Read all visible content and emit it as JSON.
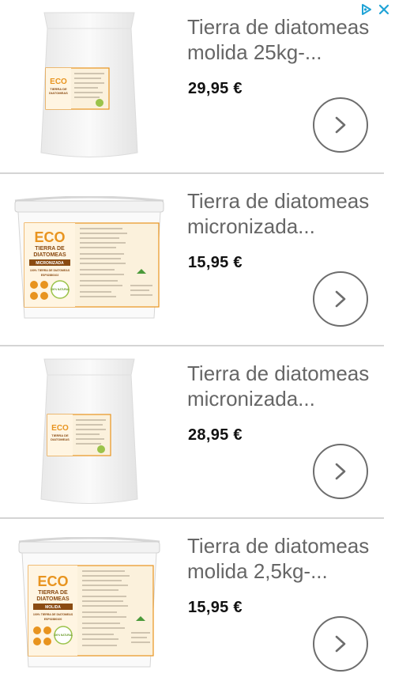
{
  "ad": {
    "icons": [
      "adchoices-triangle-icon",
      "close-x-icon"
    ],
    "accent_color": "#1fa3d6"
  },
  "products": [
    {
      "title": "Tierra de diatomeas molida 25kg-...",
      "price": "29,95 €",
      "image": "sack-icon",
      "label": {
        "brand": "ECO",
        "line1": "TIERRA DE",
        "line2": "DIATOMEAS"
      }
    },
    {
      "title": "Tierra de diatomeas micronizada...",
      "price": "15,95 €",
      "image": "bucket-icon",
      "label": {
        "brand": "ECO",
        "line1": "TIERRA DE",
        "line2": "DIATOMEAS",
        "variant": "MICRONIZADA",
        "subtitle": "100% TIERRA DE DIATOMEAS",
        "code": "ESP02880102",
        "badge": "100% NATURAL"
      }
    },
    {
      "title": "Tierra de diatomeas micronizada...",
      "price": "28,95 €",
      "image": "sack-icon",
      "label": {
        "brand": "ECO",
        "line1": "TIERRA DE",
        "line2": "DIATOMEAS"
      }
    },
    {
      "title": "Tierra de diatomeas molida 2,5kg-...",
      "price": "15,95 €",
      "image": "bucket-icon",
      "label": {
        "brand": "ECO",
        "line1": "TIERRA DE",
        "line2": "DIATOMEAS",
        "variant": "MOLIDA",
        "subtitle": "100% TIERRA DE DIATOMEAS",
        "code": "ESP02880100",
        "badge": "100% NATURAL"
      }
    }
  ],
  "colors": {
    "label_orange": "#e8941f",
    "label_cream": "#fbf1dc",
    "chevron": "#6d6d6d",
    "title": "#666666",
    "price": "#111111"
  }
}
